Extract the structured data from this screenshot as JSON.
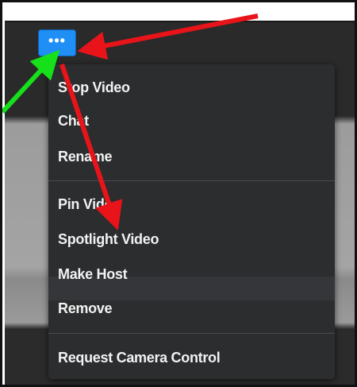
{
  "menu_button": {
    "label": "•••"
  },
  "menu": {
    "items": [
      {
        "label": "Stop Video"
      },
      {
        "label": "Chat"
      },
      {
        "label": "Rename"
      },
      {
        "label": "Pin Video"
      },
      {
        "label": "Spotlight Video"
      },
      {
        "label": "Make Host"
      },
      {
        "label": "Remove"
      },
      {
        "label": "Request Camera Control"
      }
    ]
  },
  "colors": {
    "button_blue": "#1f8ef5",
    "menu_background": "#2c2d2f",
    "menu_text": "#f2f2f2",
    "arrow_red": "#e8141a",
    "arrow_green": "#16e01a"
  }
}
